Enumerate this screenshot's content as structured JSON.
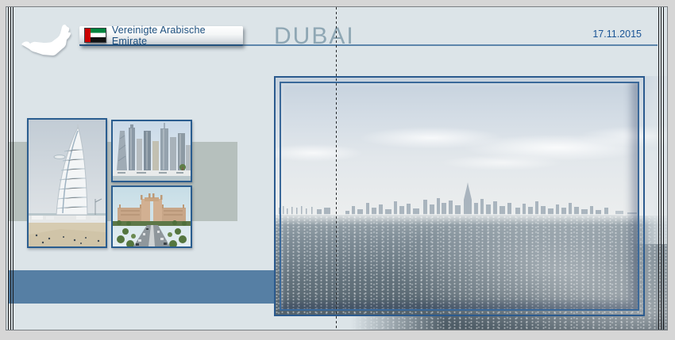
{
  "page": {
    "country_label": "Vereinigte Arabische Emirate",
    "title": "DUBAI",
    "date": "17.11.2015"
  },
  "icons": {
    "flag": "uae-flag-icon",
    "map": "uae-map-silhouette"
  },
  "photos": {
    "thumb_1": "Burj al Arab",
    "thumb_2": "Dubai Marina Hochhaeuser",
    "thumb_3": "Atlantis The Palm",
    "main": "Skyline von Dubai vom Meer"
  },
  "colors": {
    "page_bg": "#dce4e8",
    "accent_navy": "#23517d",
    "title": "#8fa7b4",
    "date": "#1b5596",
    "band_blue": "#567fa4",
    "band_gray": "#b6c0bd",
    "photo_border": "#2a5d8f"
  }
}
